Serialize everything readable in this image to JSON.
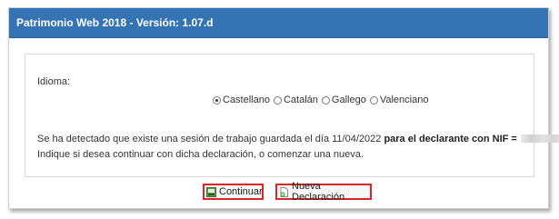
{
  "header": {
    "title": "Patrimonio Web 2018 - Versión: 1.07.d"
  },
  "form": {
    "idioma_label": "Idioma:",
    "languages": [
      {
        "label": "Castellano",
        "selected": true
      },
      {
        "label": "Catalán",
        "selected": false
      },
      {
        "label": "Gallego",
        "selected": false
      },
      {
        "label": "Valenciano",
        "selected": false
      }
    ],
    "message_prefix": "Se ha detectado que existe una sesión de trabajo guardada el día 11/04/2022 ",
    "message_bold": "para el declarante con NIF =",
    "message_line2": "Indique si desea continuar con dicha declaración, o comenzar una nueva."
  },
  "buttons": {
    "continuar": {
      "label": "Continuar",
      "icon": "continue-icon"
    },
    "nueva": {
      "label": "Nueva Declaración",
      "icon": "new-document-icon"
    }
  },
  "colors": {
    "header_bg": "#3574b4",
    "button_highlight": "#d9262c"
  }
}
